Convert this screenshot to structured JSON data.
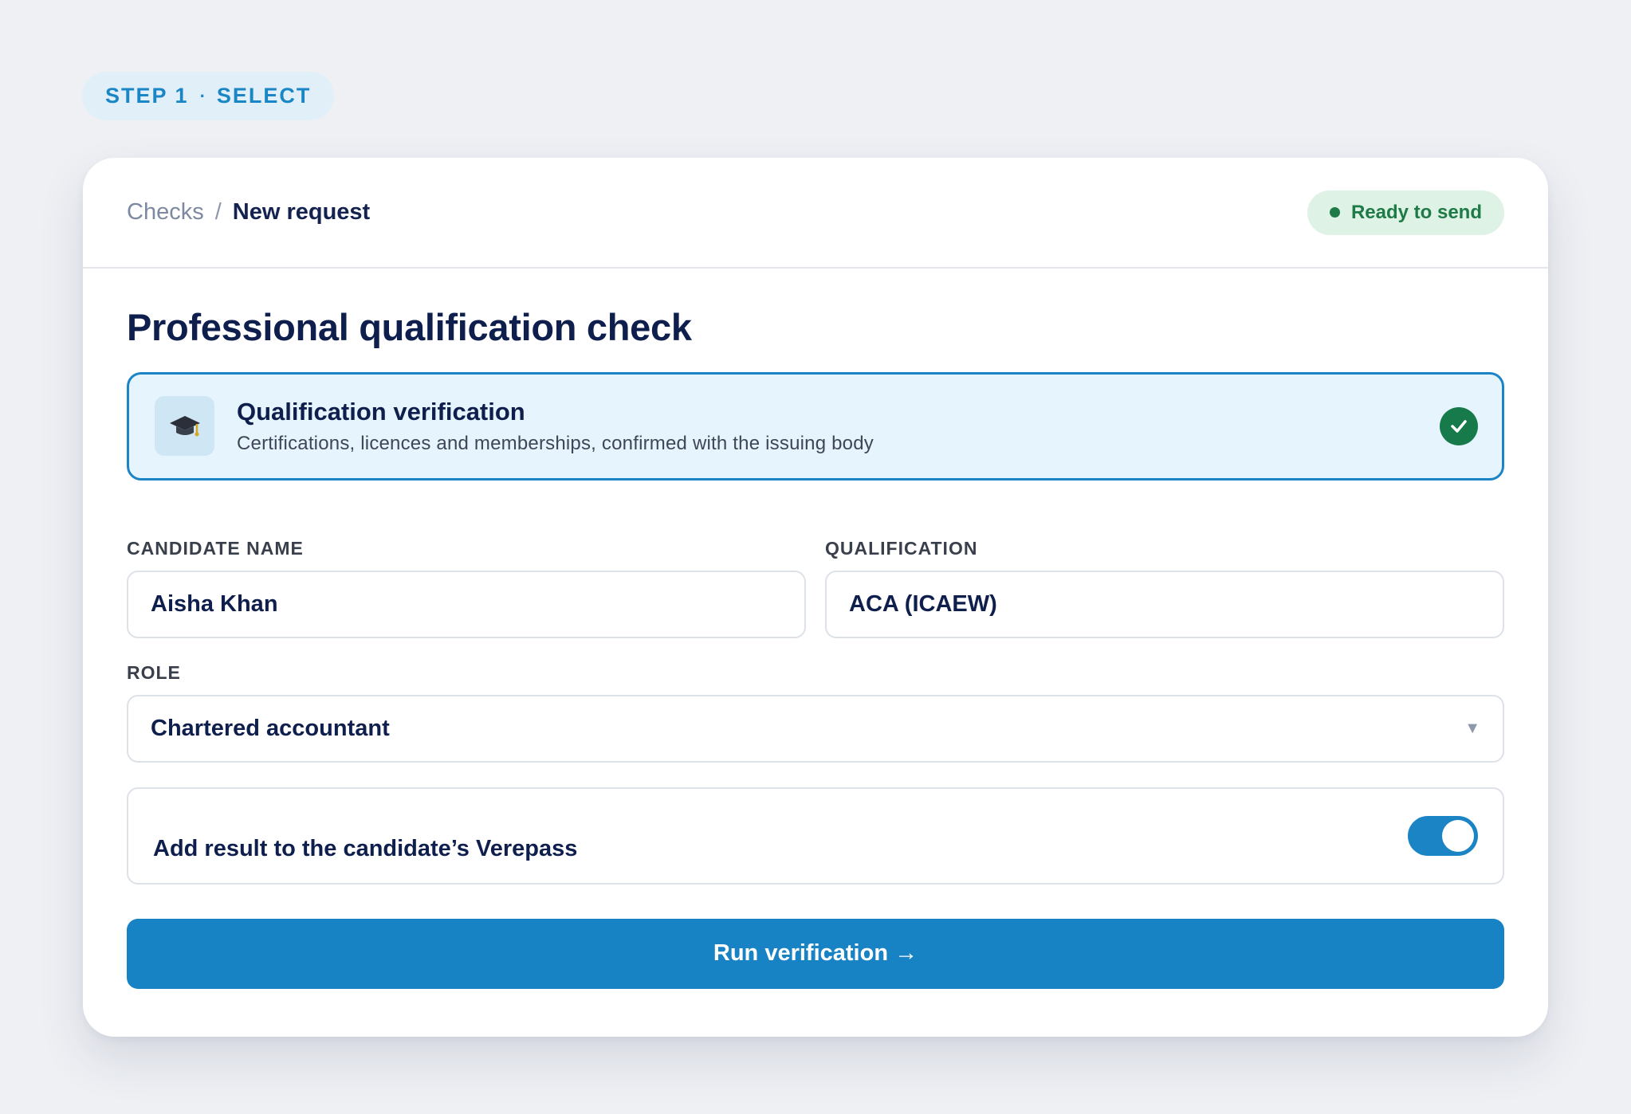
{
  "step": {
    "label": "STEP 1",
    "separator": "·",
    "name": "SELECT"
  },
  "header": {
    "breadcrumb_parent": "Checks",
    "breadcrumb_separator": "/",
    "breadcrumb_current": "New request",
    "status_label": "Ready to send",
    "status_color": "#1e7a46"
  },
  "page_title": "Professional qualification check",
  "check_type": {
    "icon": "graduation-cap-icon",
    "title": "Qualification verification",
    "description": "Certifications, licences and memberships, confirmed with the issuing body",
    "selected": true
  },
  "form": {
    "candidate_name": {
      "label": "CANDIDATE NAME",
      "value": "Aisha Khan"
    },
    "qualification": {
      "label": "QUALIFICATION",
      "value": "ACA (ICAEW)"
    },
    "role": {
      "label": "ROLE",
      "value": "Chartered accountant"
    },
    "verepass_toggle": {
      "label": "Add result to the candidate’s Verepass",
      "enabled": true
    }
  },
  "actions": {
    "run_label": "Run verification →"
  },
  "colors": {
    "accent": "#1783c5",
    "success": "#177a4a",
    "background": "#eef0f4"
  }
}
